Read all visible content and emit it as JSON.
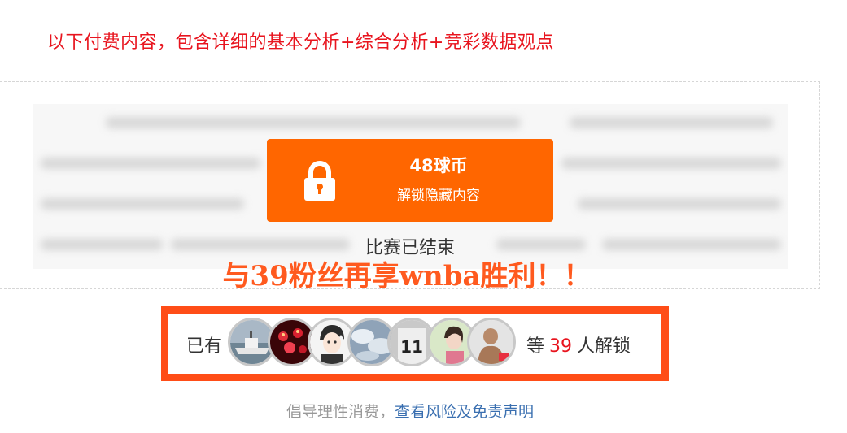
{
  "notice": "以下付费内容，包含详细的基本分析+综合分析+竞彩数据观点",
  "unlock": {
    "price": "48球币",
    "label": "解锁隐藏内容"
  },
  "match_status": "比赛已结束",
  "promo": "与39粉丝再享wnba胜利！！",
  "unlockers": {
    "prefix": "已有",
    "suffix_pre": "等",
    "count": "39",
    "suffix_post": "人解锁",
    "avatars": [
      "ship-photo",
      "candles-photo",
      "anime-character",
      "clouds-photo",
      "jersey-11",
      "selfie-photo",
      "fighter-photo"
    ]
  },
  "disclaimer": {
    "text": "倡导理性消费，",
    "link": "查看风险及免责声明"
  },
  "colors": {
    "accent": "#ff6600",
    "notice_red": "#e8141e",
    "box_border": "#ff4d17",
    "link_blue": "#3a6fb0"
  }
}
